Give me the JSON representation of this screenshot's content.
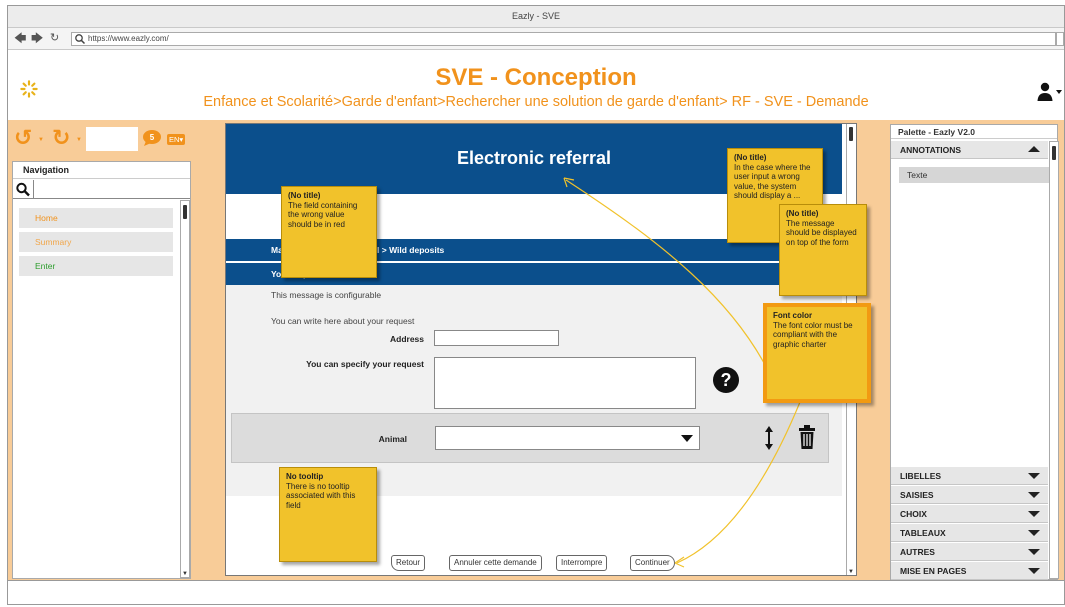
{
  "window": {
    "title": "Eazly - SVE"
  },
  "browser": {
    "url": "https://www.eazly.com/"
  },
  "header": {
    "title": "SVE - Conception",
    "breadcrumb": "Enfance et Scolarité>Garde d'enfant>Rechercher une solution de garde d'enfant> RF - SVE - Demande"
  },
  "toolbar": {
    "language": "EN",
    "notification_count": "5"
  },
  "navigation": {
    "title": "Navigation",
    "items": [
      {
        "label": "Home",
        "color": "#f1921c"
      },
      {
        "label": "Summary",
        "color": "#f1a64a"
      },
      {
        "label": "Enter",
        "color": "#2e9e2e"
      }
    ]
  },
  "form": {
    "title": "Electronic referral",
    "breadcrumb": "Ma",
    "breadcrumb_tail": "ful > Wild deposits",
    "section_title": "Your request",
    "intro1": "This message is configurable",
    "intro2": "You can write here about your request",
    "address_label": "Address",
    "request_label": "You can specify your request",
    "animal_label": "Animal",
    "buttons": {
      "back": "Retour",
      "cancel": "Annuler cette demande",
      "interrupt": "Interrompre",
      "continue": "Continuer"
    }
  },
  "notes": [
    {
      "title": "(No title)",
      "text": "The field containing the wrong value should be in red"
    },
    {
      "title": "(No title)",
      "text": "In the case where the user input a wrong value, the system should display a ..."
    },
    {
      "title": "(No title)",
      "text": "The message should be displayed on top of the form"
    },
    {
      "title": "Font color",
      "text": "The font color must be compliant with the graphic charter"
    },
    {
      "title": "No tooltip",
      "text": "There is no tooltip associated with this field"
    }
  ],
  "palette": {
    "title": "Palette - Eazly V2.0",
    "annotations": "ANNOTATIONS",
    "annotation_item": "Texte",
    "sections": [
      "LIBELLES",
      "SAISIES",
      "CHOIX",
      "TABLEAUX",
      "AUTRES",
      "MISE EN PAGES"
    ]
  },
  "colors": {
    "accent": "#f1921c",
    "brand_blue": "#0b4f8c",
    "workspace": "#f8cc98",
    "note": "#f1c22b"
  }
}
